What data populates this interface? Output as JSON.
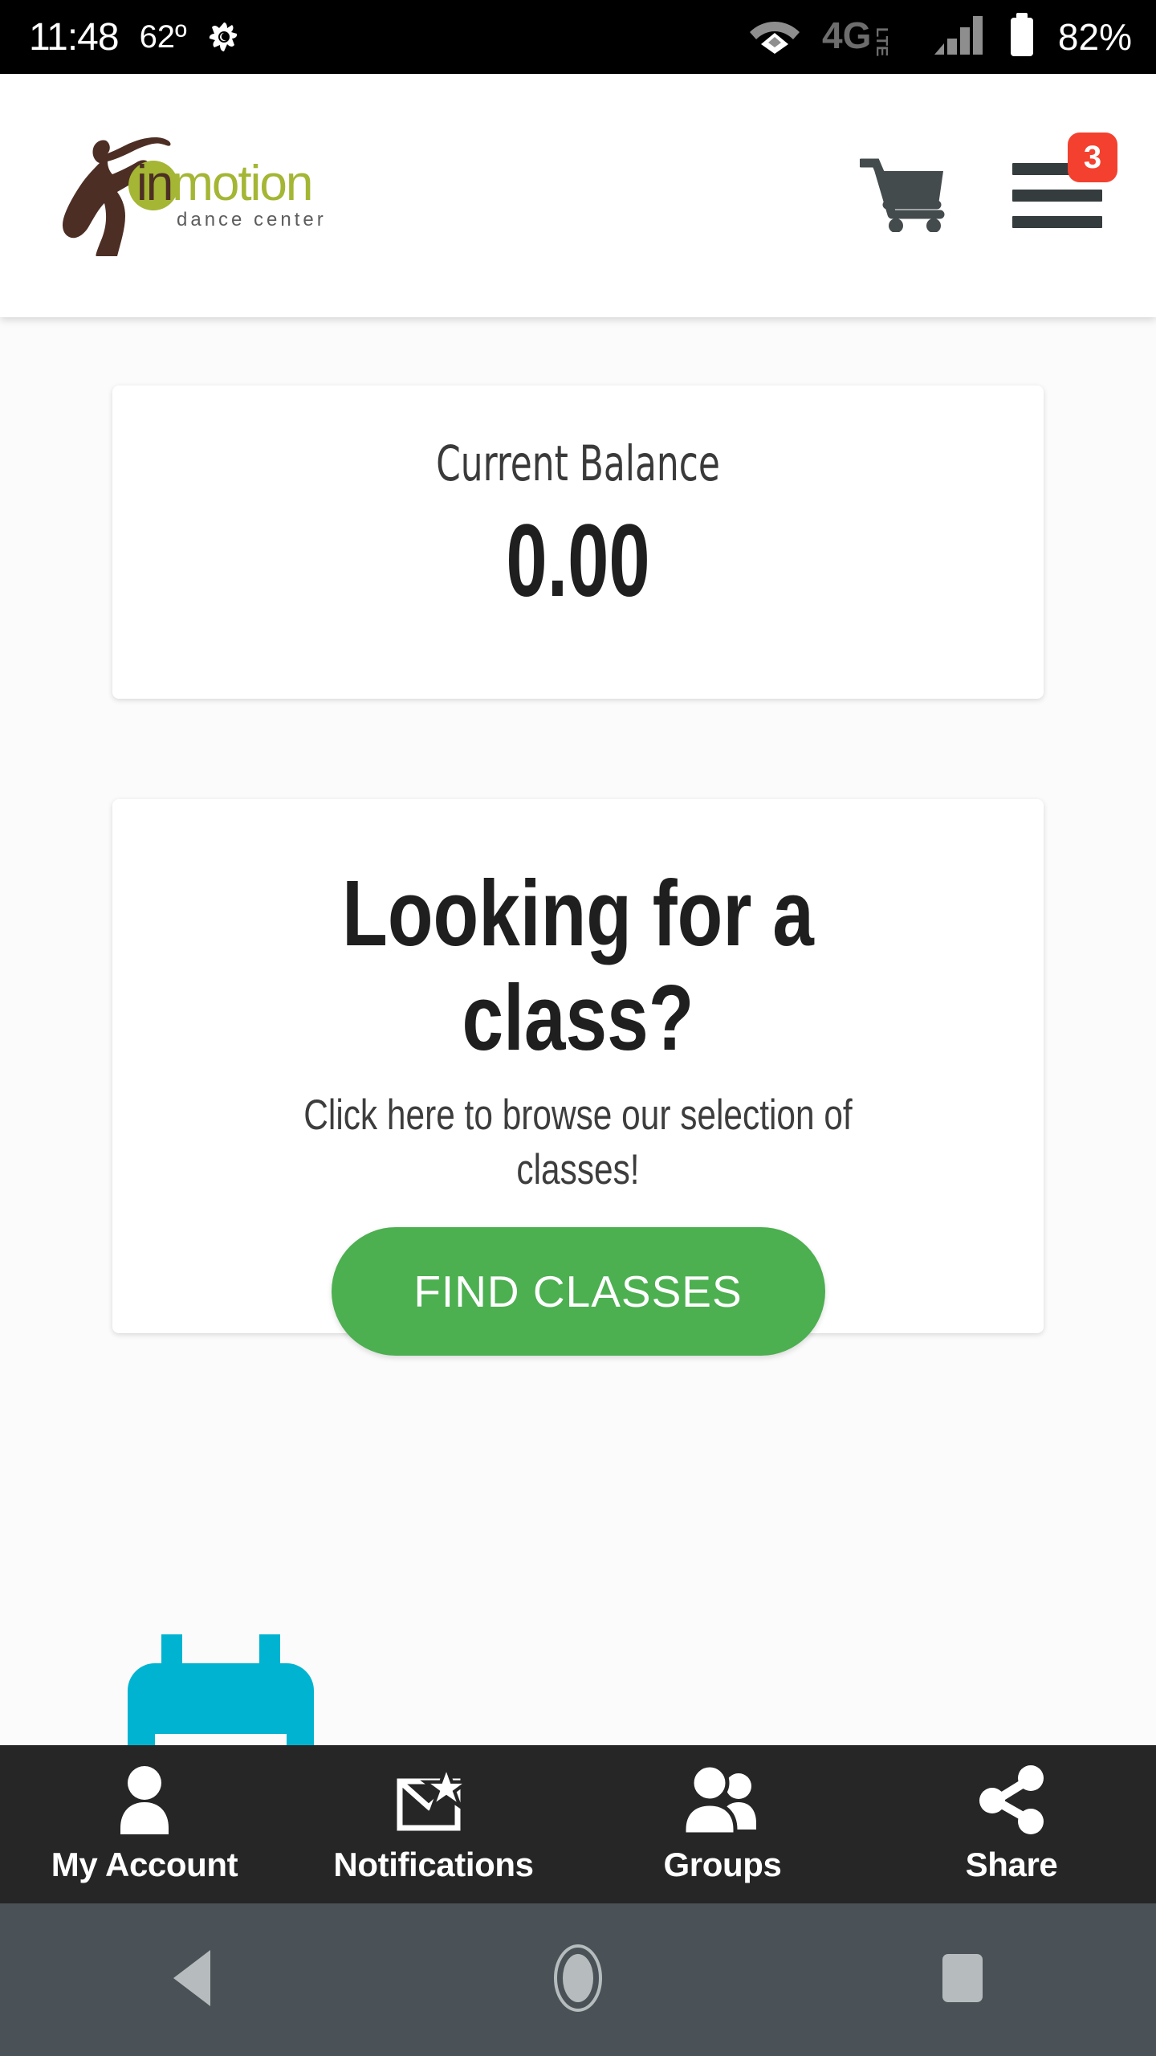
{
  "status_bar": {
    "time": "11:48",
    "temperature": "62º",
    "weather_icon": "weather-icon",
    "wifi_icon": "wifi-icon",
    "network_label": "4G LTE",
    "signal_icon": "signal-bars-icon",
    "battery_icon": "battery-icon",
    "battery_percent": "82%"
  },
  "header": {
    "logo_name": "inmotion dance center",
    "logo_primary_text": "inmotion",
    "logo_secondary_text": "dance center",
    "logo_green": "#a4b634",
    "logo_brown": "#4d2e24",
    "cart_icon": "shopping-cart-icon",
    "menu_icon": "hamburger-menu-icon",
    "menu_badge_count": "3",
    "badge_color": "#f4402e",
    "icon_color": "#353c3e"
  },
  "balance_card": {
    "label": "Current Balance",
    "value": "0.00"
  },
  "class_card": {
    "title": "Looking for a class?",
    "subtitle": "Click here to browse our selection of classes!",
    "button_label": "FIND CLASSES",
    "button_color": "#4caf50"
  },
  "decorative": {
    "teal_icon": "bed-icon",
    "teal_color": "#00b4d1"
  },
  "tab_bar": {
    "background": "#262626",
    "items": [
      {
        "label": "My Account",
        "icon": "person-icon"
      },
      {
        "label": "Notifications",
        "icon": "envelope-star-icon"
      },
      {
        "label": "Groups",
        "icon": "people-group-icon"
      },
      {
        "label": "Share",
        "icon": "share-nodes-icon"
      }
    ]
  },
  "android_nav": {
    "background": "#4a5257",
    "buttons": [
      {
        "name": "back",
        "icon": "back-triangle-icon"
      },
      {
        "name": "home",
        "icon": "home-circle-icon"
      },
      {
        "name": "recents",
        "icon": "recents-square-icon"
      }
    ]
  }
}
